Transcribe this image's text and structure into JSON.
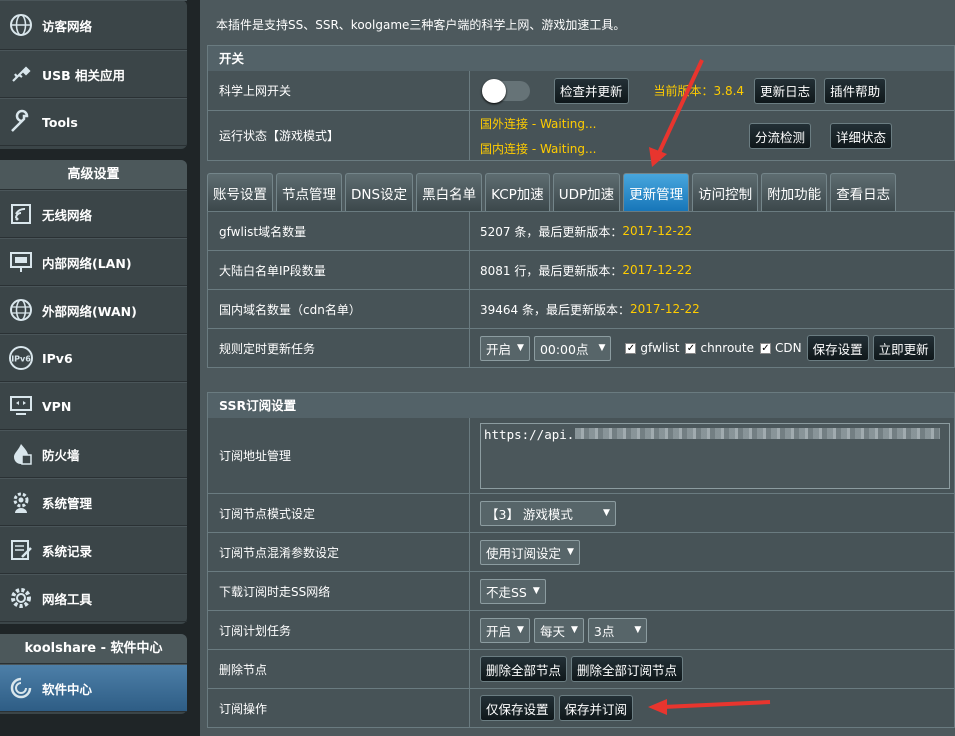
{
  "sidebar": {
    "top_items": [
      {
        "label": "访客网络",
        "icon": "globe-network-icon"
      },
      {
        "label": "USB 相关应用",
        "icon": "usb-icon"
      },
      {
        "label": "Tools",
        "icon": "wrench-icon"
      }
    ],
    "advanced_header": "高级设置",
    "advanced_items": [
      {
        "label": "无线网络",
        "icon": "wifi-icon"
      },
      {
        "label": "内部网络(LAN)",
        "icon": "lan-icon"
      },
      {
        "label": "外部网络(WAN)",
        "icon": "globe-icon"
      },
      {
        "label": "IPv6",
        "icon": "ipv6-icon"
      },
      {
        "label": "VPN",
        "icon": "vpn-icon"
      },
      {
        "label": "防火墙",
        "icon": "firewall-icon"
      },
      {
        "label": "系统管理",
        "icon": "gear-person-icon"
      },
      {
        "label": "系统记录",
        "icon": "log-icon"
      },
      {
        "label": "网络工具",
        "icon": "gear-icon"
      }
    ],
    "store_header": "koolshare - 软件中心",
    "store_items": [
      {
        "label": "软件中心",
        "icon": "software-center-icon"
      }
    ]
  },
  "intro": "本插件是支持SS、SSR、koolgame三种客户端的科学上网、游戏加速工具。",
  "switch_section": {
    "title": "开关",
    "row1_label": "科学上网开关",
    "check_update": "检查并更新",
    "current_version": "当前版本：3.8.4",
    "changelog": "更新日志",
    "plugin_help": "插件帮助",
    "row2_label": "运行状态【游戏模式】",
    "status_foreign": "国外连接 - Waiting...",
    "status_domestic": "国内连接 - Waiting...",
    "split_detect": "分流检测",
    "detail_status": "详细状态"
  },
  "tabs": [
    "账号设置",
    "节点管理",
    "DNS设定",
    "黑白名单",
    "KCP加速",
    "UDP加速",
    "更新管理",
    "访问控制",
    "附加功能",
    "查看日志"
  ],
  "update": {
    "rows": [
      {
        "label": "gfwlist域名数量",
        "value": "5207 条，最后更新版本：",
        "version": "2017-12-22"
      },
      {
        "label": "大陆白名单IP段数量",
        "value": "8081 行，最后更新版本：",
        "version": "2017-12-22"
      },
      {
        "label": "国内域名数量（cdn名单）",
        "value": "39464 条，最后更新版本：",
        "version": "2017-12-22"
      }
    ],
    "schedule_label": "规则定时更新任务",
    "schedule_enable": "开启",
    "schedule_time": "00:00点",
    "chk_gfwlist": "gfwlist",
    "chk_chnroute": "chnroute",
    "chk_cdn": "CDN",
    "save": "保存设置",
    "update_now": "立即更新"
  },
  "ssr": {
    "title": "SSR订阅设置",
    "url_label": "订阅地址管理",
    "url_value": "https://api.",
    "mode_label": "订阅节点模式设定",
    "mode_value": "【3】 游戏模式",
    "obfs_label": "订阅节点混淆参数设定",
    "obfs_value": "使用订阅设定",
    "via_ss_label": "下载订阅时走SS网络",
    "via_ss_value": "不走SS",
    "plan_label": "订阅计划任务",
    "plan_enable": "开启",
    "plan_day": "每天",
    "plan_hour": "3点",
    "delete_label": "删除节点",
    "delete_all": "删除全部节点",
    "delete_sub": "删除全部订阅节点",
    "op_label": "订阅操作",
    "save_only": "仅保存设置",
    "save_sub": "保存并订阅"
  },
  "colors": {
    "accent_tab": "#1f8fd6",
    "version_text": "#ffcc00",
    "arrow": "#e8352e"
  }
}
